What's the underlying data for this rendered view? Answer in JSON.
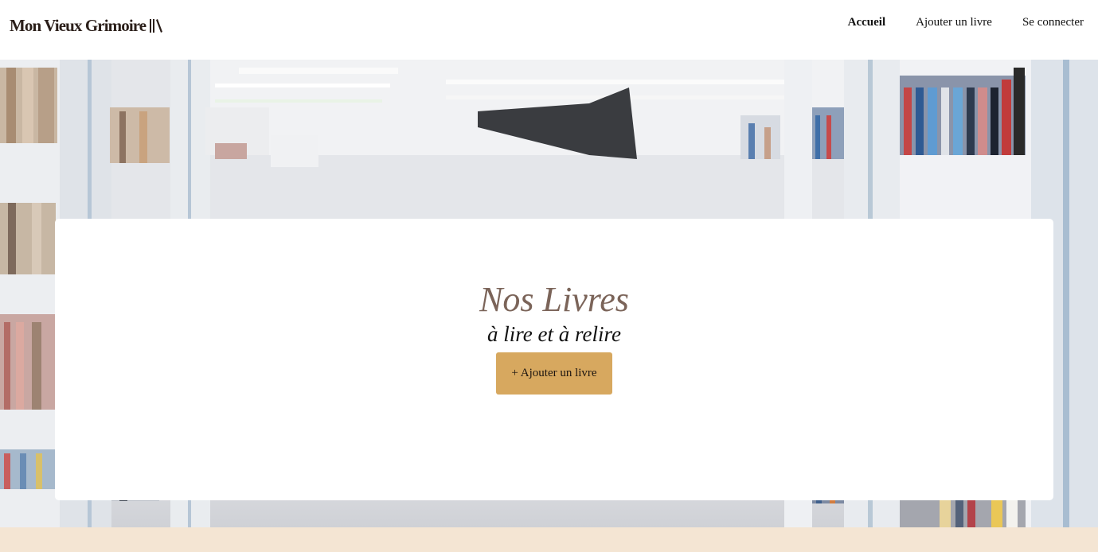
{
  "header": {
    "logo_text": "Mon Vieux Grimoire",
    "logo_icon": "books-icon",
    "nav": [
      {
        "label": "Accueil",
        "active": true
      },
      {
        "label": "Ajouter un livre",
        "active": false
      },
      {
        "label": "Se connecter",
        "active": false
      }
    ]
  },
  "hero": {
    "background": "library-bookshelves-photo",
    "title": "Nos Livres",
    "subtitle": "à lire et à relire",
    "add_button_label": "+ Ajouter un livre"
  },
  "colors": {
    "title_brown": "#7b6459",
    "button_gold": "#d7a85f",
    "footer_beige": "#f4e5d3",
    "logo_dark": "#2b1f1a"
  }
}
